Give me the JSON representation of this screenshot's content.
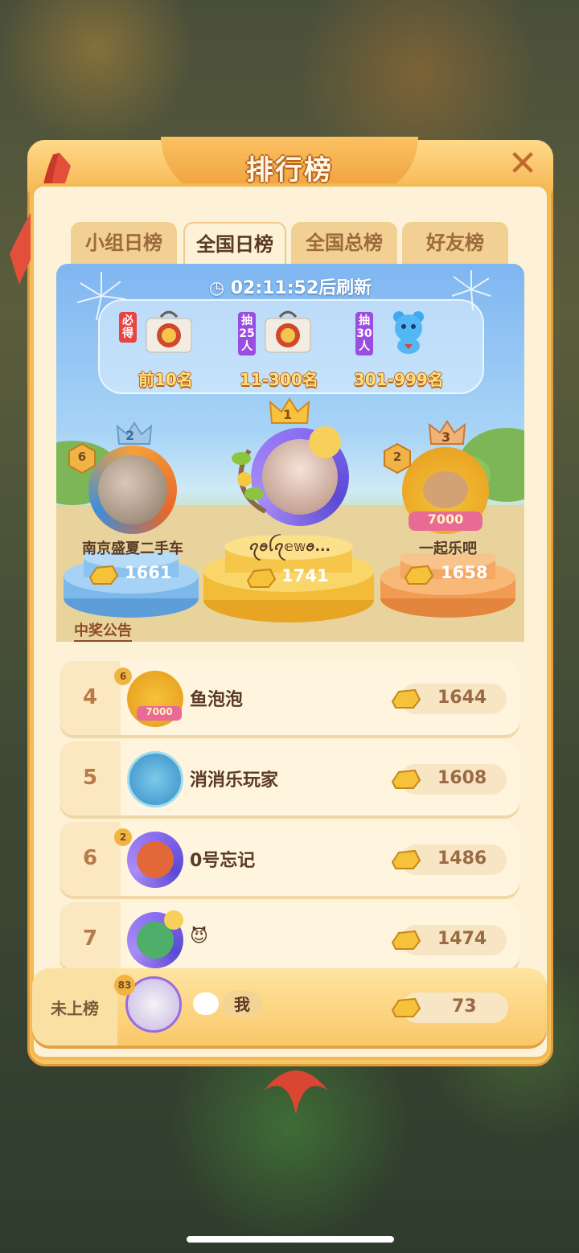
{
  "title": "排行榜",
  "tabs": [
    {
      "label": "小组日榜",
      "active": false
    },
    {
      "label": "全国日榜",
      "active": true
    },
    {
      "label": "全国总榜",
      "active": false
    },
    {
      "label": "好友榜",
      "active": false
    }
  ],
  "refresh": {
    "countdown": "02:11:52",
    "suffix": "后刷新"
  },
  "rewards": [
    {
      "tag": "必得",
      "range": "前10名"
    },
    {
      "tag": "抽25人",
      "range": "11-300名"
    },
    {
      "tag": "抽30人",
      "range": "301-999名"
    }
  ],
  "top3": [
    {
      "rank": "2",
      "name": "南京盛夏二手车",
      "score": "1661",
      "level": "6"
    },
    {
      "rank": "1",
      "name": "ꪖꪮꪶꪖ𝕖𝕨ꪮ...",
      "score": "1741"
    },
    {
      "rank": "3",
      "name": "一起乐吧",
      "score": "1658",
      "level": "2",
      "badge": "7000"
    }
  ],
  "announce": "中奖公告",
  "list": [
    {
      "rank": "4",
      "name": "鱼泡泡",
      "score": "1644",
      "level": "6",
      "badge": "7000"
    },
    {
      "rank": "5",
      "name": "消消乐玩家",
      "score": "1608"
    },
    {
      "rank": "6",
      "name": "0号忘记",
      "score": "1486",
      "level": "2"
    },
    {
      "rank": "7",
      "name": "😈",
      "score": "1474"
    }
  ],
  "self": {
    "status": "未上榜",
    "name": "我",
    "score": "73",
    "level": "83"
  },
  "colors": {
    "accent": "#f5b54e",
    "text": "#5a3a25",
    "gold": "#f2b624"
  }
}
